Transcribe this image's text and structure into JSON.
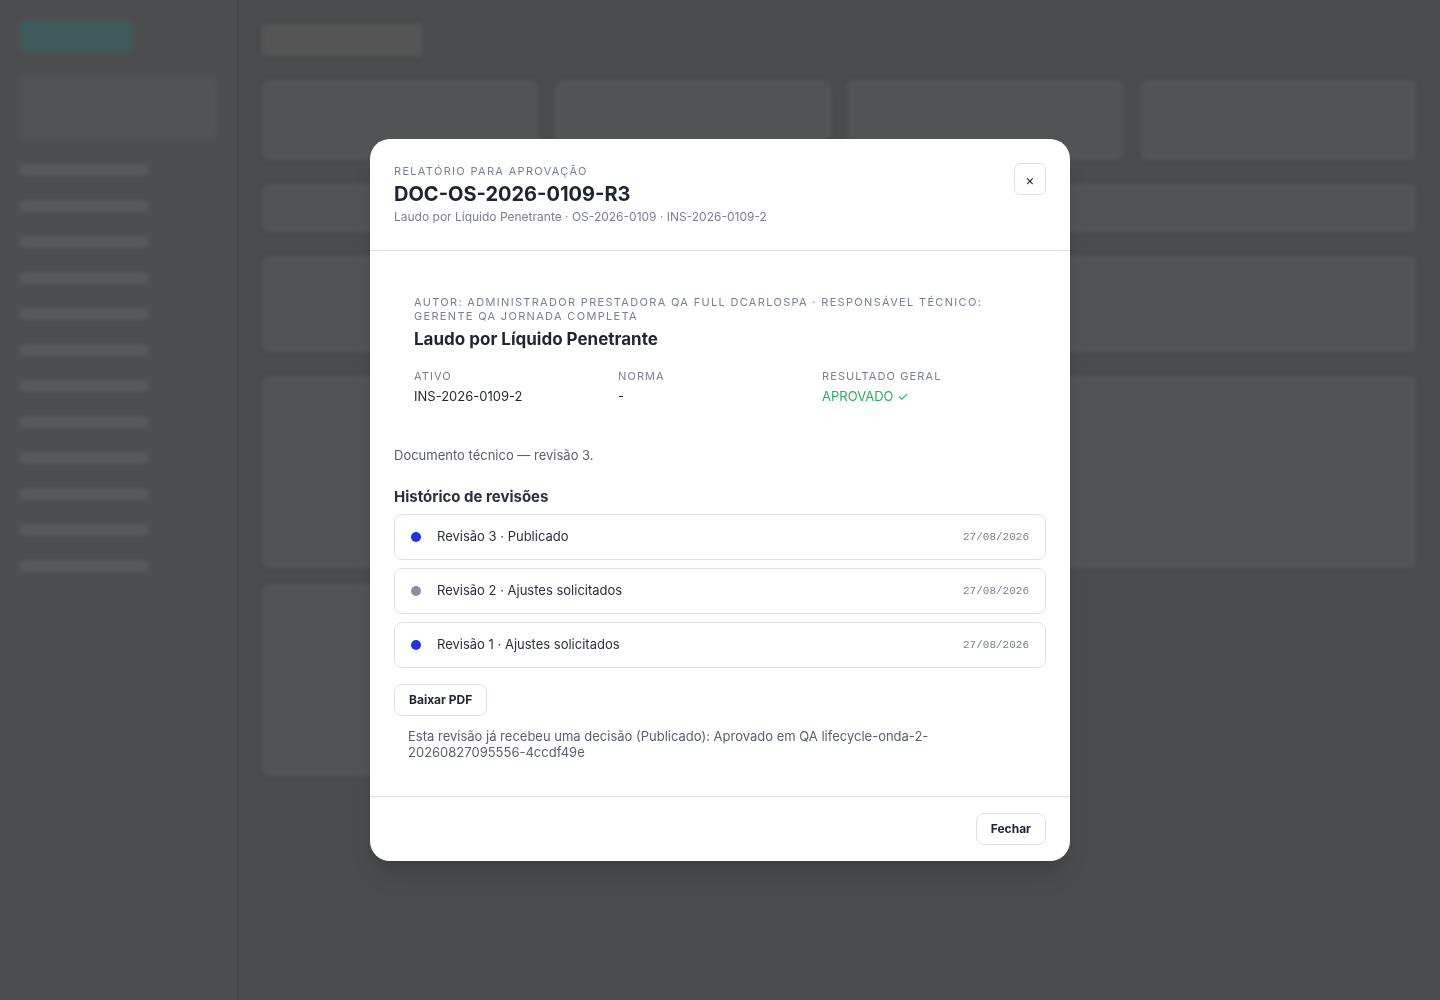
{
  "dialog": {
    "eyebrow": "RELATÓRIO PARA APROVAÇÃO",
    "title": "DOC-OS-2026-0109-R3",
    "subtitle": "Laudo por Líquido Penetrante · OS-2026-0109 · INS-2026-0109-2",
    "close_icon": "×",
    "report": {
      "meta": "AUTOR: ADMINISTRADOR PRESTADORA QA FULL DCARLOSPA · RESPONSÁVEL TÉCNICO: GERENTE QA JORNADA COMPLETA",
      "title": "Laudo por Líquido Penetrante",
      "fields": [
        {
          "label": "ATIVO",
          "value": "INS-2026-0109-2",
          "kind": "plain"
        },
        {
          "label": "NORMA",
          "value": "-",
          "kind": "plain"
        },
        {
          "label": "RESULTADO GERAL",
          "value": "APROVADO ✓",
          "kind": "success"
        }
      ]
    },
    "description": "Documento técnico — revisão 3.",
    "history_title": "Histórico de revisões",
    "revisions": [
      {
        "label": "Revisão 3 · Publicado",
        "date": "27/08/2026",
        "color": "#1d34e0"
      },
      {
        "label": "Revisão 2 · Ajustes solicitados",
        "date": "27/08/2026",
        "color": "#8a8fa3"
      },
      {
        "label": "Revisão 1 · Ajustes solicitados",
        "date": "27/08/2026",
        "color": "#1d34e0"
      }
    ],
    "download_button": "Baixar PDF",
    "notice": "Esta revisão já recebeu uma decisão (Publicado): Aprovado em QA lifecycle-onda-2-20260827095556-4ccdf49e",
    "footer_button": "Fechar"
  }
}
